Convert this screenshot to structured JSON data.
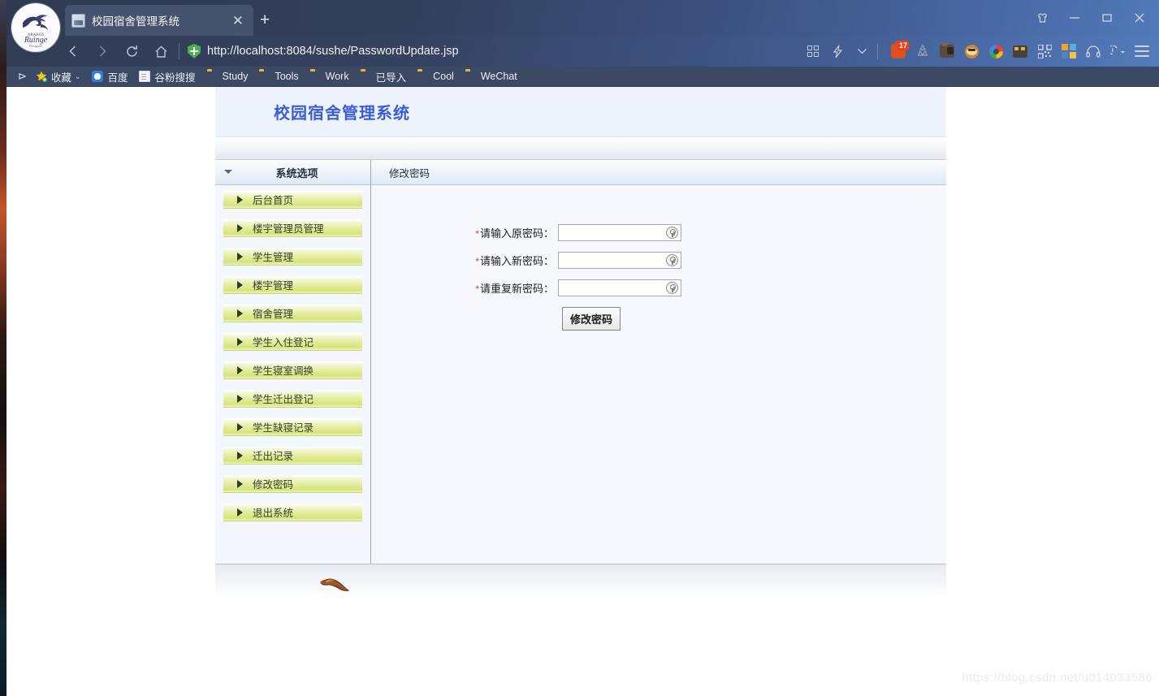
{
  "browser": {
    "tab": {
      "title": "校园宿舍管理系统",
      "close_label": "✕",
      "favicon": "image-favicon"
    },
    "new_tab_label": "+",
    "window_controls": {
      "shirt": "collect-icon",
      "minimize": "—",
      "maximize": "▢",
      "close": "✕"
    },
    "nav": {
      "back": "‹",
      "forward": "›",
      "reload": "⟳",
      "home": "⌂"
    },
    "url": "http://localhost:8084/sushe/PasswordUpdate.jsp",
    "url_security_icon": "green-shield-icon",
    "extensions": [
      {
        "name": "apps-grid-icon",
        "badge": ""
      },
      {
        "name": "lightning-icon",
        "badge": ""
      },
      {
        "name": "chevron-down-icon",
        "badge": ""
      },
      {
        "name": "lock-icon",
        "badge": "17"
      },
      {
        "name": "recycle-icon",
        "badge": ""
      },
      {
        "name": "camera-icon",
        "badge": ""
      },
      {
        "name": "monkey-icon",
        "badge": ""
      },
      {
        "name": "google-icon",
        "badge": ""
      },
      {
        "name": "calculator-icon",
        "badge": ""
      },
      {
        "name": "qrcode-icon",
        "badge": ""
      },
      {
        "name": "windows-squares-icon",
        "badge": ""
      },
      {
        "name": "headphones-icon",
        "badge": ""
      },
      {
        "name": "undo-icon",
        "badge": ""
      },
      {
        "name": "hamburger-menu-icon",
        "badge": ""
      }
    ],
    "bookmarks": [
      {
        "label": "收藏",
        "icon": "star-icon",
        "chevron": "⌄"
      },
      {
        "label": "百度",
        "icon": "baidu-icon",
        "chevron": ""
      },
      {
        "label": "谷粉搜搜",
        "icon": "document-icon",
        "chevron": ""
      },
      {
        "label": "Study",
        "icon": "folder-icon",
        "chevron": ""
      },
      {
        "label": "Tools",
        "icon": "folder-icon",
        "chevron": ""
      },
      {
        "label": "Work",
        "icon": "folder-icon",
        "chevron": ""
      },
      {
        "label": "已导入",
        "icon": "folder-icon",
        "chevron": ""
      },
      {
        "label": "Cool",
        "icon": "folder-icon",
        "chevron": ""
      },
      {
        "label": "WeChat",
        "icon": "folder-icon",
        "chevron": ""
      }
    ],
    "bookmarks_overflow_icon": "bookmarks-list-icon"
  },
  "site": {
    "title": "校园宿舍管理系统",
    "sidebar": {
      "header": "系统选项",
      "items": [
        {
          "label": "后台首页"
        },
        {
          "label": "楼宇管理员管理"
        },
        {
          "label": "学生管理"
        },
        {
          "label": "楼宇管理"
        },
        {
          "label": "宿舍管理"
        },
        {
          "label": "学生入住登记"
        },
        {
          "label": "学生寝室调换"
        },
        {
          "label": "学生迁出登记"
        },
        {
          "label": "学生缺寝记录"
        },
        {
          "label": "迁出记录"
        },
        {
          "label": "修改密码"
        },
        {
          "label": "退出系统"
        }
      ]
    },
    "content": {
      "panel_title": "修改密码",
      "fields": [
        {
          "label": "请输入原密码：",
          "value": "",
          "placeholder": "",
          "required": true
        },
        {
          "label": "请输入新密码：",
          "value": "",
          "placeholder": "",
          "required": true
        },
        {
          "label": "请重复新密码：",
          "value": "",
          "placeholder": "",
          "required": true
        }
      ],
      "required_marker": "*",
      "submit_label": "修改密码"
    }
  },
  "watermark": "https://blog.csdn.net/u014033586",
  "colors": {
    "chrome": "#3c4964",
    "site_title": "#3b5bdb",
    "menu_gradient_end": "#d4e47a",
    "required": "#d24b16",
    "badge": "#e8441f"
  }
}
